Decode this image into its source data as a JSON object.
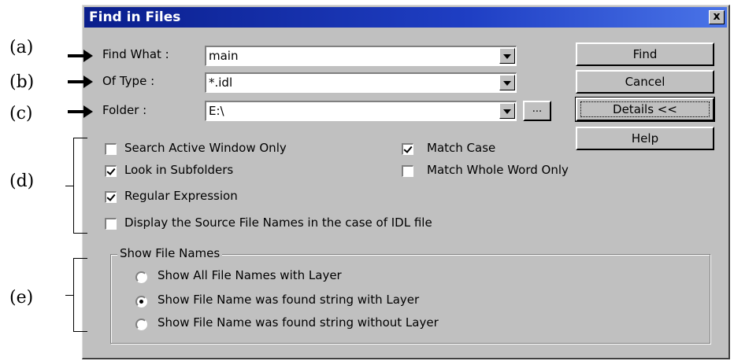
{
  "dialog": {
    "title": "Find in Files",
    "close_glyph": "x"
  },
  "annotations": [
    "(a)",
    "(b)",
    "(c)",
    "(d)",
    "(e)"
  ],
  "fields": {
    "find_what": {
      "label": "Find What :",
      "value": "main"
    },
    "of_type": {
      "label": "Of Type :",
      "value": "*.idl"
    },
    "folder": {
      "label": "Folder :",
      "value": "E:\\"
    }
  },
  "browse_button_label": "...",
  "buttons": {
    "find": "Find",
    "cancel": "Cancel",
    "details": "Details <<",
    "help": "Help"
  },
  "checkboxes": [
    {
      "label": "Search Active Window Only",
      "checked": false
    },
    {
      "label": "Look in Subfolders",
      "checked": true
    },
    {
      "label": "Regular Expression",
      "checked": true
    },
    {
      "label": "Display the Source File Names in the case of IDL file",
      "checked": false
    },
    {
      "label": "Match Case",
      "checked": true
    },
    {
      "label": "Match Whole Word Only",
      "checked": false
    }
  ],
  "show_file_names": {
    "title": "Show File Names",
    "options": [
      {
        "label": "Show All File Names with Layer",
        "selected": false
      },
      {
        "label": "Show File Name was found string with Layer",
        "selected": true
      },
      {
        "label": "Show File Name was found string without Layer",
        "selected": false
      }
    ]
  },
  "colors": {
    "title_bar": "#0a1e8c",
    "dialog_face": "#c0c0c0"
  },
  "icons": [
    "close-icon",
    "dropdown-arrow-icon",
    "checkmark-icon",
    "radio-dot-icon",
    "arrow-pointer-icon"
  ]
}
